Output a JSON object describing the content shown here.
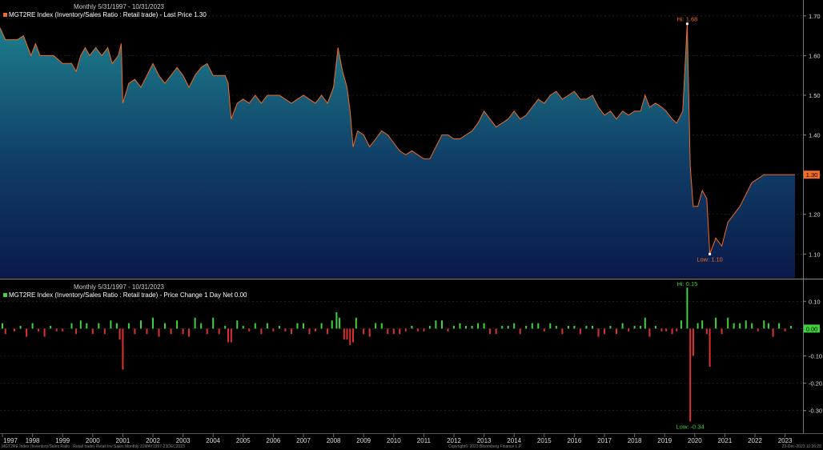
{
  "chart_data": [
    {
      "type": "area",
      "header": "Monthly 5/31/1997 - 10/31/2023",
      "legend": "MGT2RE Index (Inventory/Sales Ratio : Retail trade) - Last Price 1.30",
      "series_color": "#f26b21",
      "last_value": 1.3,
      "last_label": "1.30",
      "hi_label": "Hi: 1.68",
      "hi": {
        "x": 2020.25,
        "y": 1.68
      },
      "low_label": "Low: 1.10",
      "low": {
        "x": 2021.0,
        "y": 1.1
      },
      "ylim": [
        1.04,
        1.74
      ],
      "yticks": [
        1.1,
        1.2,
        1.3,
        1.4,
        1.5,
        1.6,
        1.7
      ],
      "ytick_labels": [
        "1.10",
        "1.20",
        "1.30",
        "1.40",
        "1.50",
        "1.60",
        "1.70"
      ],
      "points": [
        [
          1997.42,
          1.67
        ],
        [
          1997.6,
          1.64
        ],
        [
          1998.0,
          1.64
        ],
        [
          1998.2,
          1.65
        ],
        [
          1998.35,
          1.62
        ],
        [
          1998.45,
          1.6
        ],
        [
          1998.6,
          1.63
        ],
        [
          1998.75,
          1.6
        ],
        [
          1999.0,
          1.6
        ],
        [
          1999.2,
          1.6
        ],
        [
          1999.5,
          1.58
        ],
        [
          1999.8,
          1.58
        ],
        [
          1999.95,
          1.56
        ],
        [
          2000.1,
          1.6
        ],
        [
          2000.25,
          1.62
        ],
        [
          2000.4,
          1.6
        ],
        [
          2000.6,
          1.62
        ],
        [
          2000.8,
          1.6
        ],
        [
          2001.0,
          1.62
        ],
        [
          2001.15,
          1.58
        ],
        [
          2001.35,
          1.6
        ],
        [
          2001.45,
          1.63
        ],
        [
          2001.5,
          1.48
        ],
        [
          2001.7,
          1.53
        ],
        [
          2001.9,
          1.54
        ],
        [
          2002.1,
          1.52
        ],
        [
          2002.3,
          1.55
        ],
        [
          2002.5,
          1.58
        ],
        [
          2002.7,
          1.55
        ],
        [
          2002.9,
          1.53
        ],
        [
          2003.1,
          1.55
        ],
        [
          2003.3,
          1.57
        ],
        [
          2003.5,
          1.55
        ],
        [
          2003.7,
          1.52
        ],
        [
          2003.9,
          1.55
        ],
        [
          2004.1,
          1.57
        ],
        [
          2004.3,
          1.58
        ],
        [
          2004.5,
          1.55
        ],
        [
          2004.7,
          1.55
        ],
        [
          2004.9,
          1.55
        ],
        [
          2005.0,
          1.53
        ],
        [
          2005.1,
          1.44
        ],
        [
          2005.3,
          1.48
        ],
        [
          2005.5,
          1.49
        ],
        [
          2005.7,
          1.48
        ],
        [
          2005.9,
          1.5
        ],
        [
          2006.1,
          1.48
        ],
        [
          2006.3,
          1.5
        ],
        [
          2006.5,
          1.5
        ],
        [
          2006.7,
          1.5
        ],
        [
          2006.9,
          1.49
        ],
        [
          2007.1,
          1.48
        ],
        [
          2007.3,
          1.49
        ],
        [
          2007.5,
          1.5
        ],
        [
          2007.7,
          1.49
        ],
        [
          2007.9,
          1.48
        ],
        [
          2008.1,
          1.5
        ],
        [
          2008.3,
          1.48
        ],
        [
          2008.5,
          1.52
        ],
        [
          2008.65,
          1.62
        ],
        [
          2008.8,
          1.56
        ],
        [
          2008.95,
          1.52
        ],
        [
          2009.05,
          1.46
        ],
        [
          2009.15,
          1.37
        ],
        [
          2009.3,
          1.41
        ],
        [
          2009.5,
          1.4
        ],
        [
          2009.7,
          1.37
        ],
        [
          2009.9,
          1.39
        ],
        [
          2010.1,
          1.41
        ],
        [
          2010.3,
          1.4
        ],
        [
          2010.5,
          1.38
        ],
        [
          2010.7,
          1.36
        ],
        [
          2010.9,
          1.35
        ],
        [
          2011.1,
          1.36
        ],
        [
          2011.3,
          1.35
        ],
        [
          2011.5,
          1.34
        ],
        [
          2011.7,
          1.34
        ],
        [
          2011.9,
          1.37
        ],
        [
          2012.1,
          1.4
        ],
        [
          2012.3,
          1.4
        ],
        [
          2012.5,
          1.39
        ],
        [
          2012.7,
          1.39
        ],
        [
          2012.9,
          1.4
        ],
        [
          2013.1,
          1.41
        ],
        [
          2013.3,
          1.43
        ],
        [
          2013.5,
          1.46
        ],
        [
          2013.7,
          1.44
        ],
        [
          2013.9,
          1.42
        ],
        [
          2014.1,
          1.43
        ],
        [
          2014.3,
          1.44
        ],
        [
          2014.5,
          1.46
        ],
        [
          2014.7,
          1.44
        ],
        [
          2014.9,
          1.45
        ],
        [
          2015.1,
          1.47
        ],
        [
          2015.3,
          1.49
        ],
        [
          2015.5,
          1.48
        ],
        [
          2015.7,
          1.5
        ],
        [
          2015.9,
          1.51
        ],
        [
          2016.1,
          1.49
        ],
        [
          2016.3,
          1.5
        ],
        [
          2016.5,
          1.51
        ],
        [
          2016.7,
          1.49
        ],
        [
          2016.9,
          1.49
        ],
        [
          2017.1,
          1.5
        ],
        [
          2017.3,
          1.47
        ],
        [
          2017.5,
          1.45
        ],
        [
          2017.7,
          1.46
        ],
        [
          2017.9,
          1.44
        ],
        [
          2018.1,
          1.46
        ],
        [
          2018.3,
          1.45
        ],
        [
          2018.5,
          1.46
        ],
        [
          2018.7,
          1.46
        ],
        [
          2018.85,
          1.5
        ],
        [
          2019.0,
          1.47
        ],
        [
          2019.2,
          1.48
        ],
        [
          2019.4,
          1.47
        ],
        [
          2019.55,
          1.46
        ],
        [
          2019.75,
          1.44
        ],
        [
          2019.9,
          1.43
        ],
        [
          2020.1,
          1.46
        ],
        [
          2020.25,
          1.68
        ],
        [
          2020.35,
          1.32
        ],
        [
          2020.45,
          1.22
        ],
        [
          2020.6,
          1.22
        ],
        [
          2020.75,
          1.26
        ],
        [
          2020.9,
          1.24
        ],
        [
          2021.0,
          1.1
        ],
        [
          2021.2,
          1.14
        ],
        [
          2021.4,
          1.12
        ],
        [
          2021.6,
          1.18
        ],
        [
          2021.8,
          1.2
        ],
        [
          2022.0,
          1.22
        ],
        [
          2022.2,
          1.25
        ],
        [
          2022.4,
          1.28
        ],
        [
          2022.6,
          1.29
        ],
        [
          2022.8,
          1.3
        ],
        [
          2023.0,
          1.3
        ],
        [
          2023.2,
          1.3
        ],
        [
          2023.5,
          1.3
        ],
        [
          2023.83,
          1.3
        ]
      ]
    },
    {
      "type": "bar",
      "header": "Monthly 5/31/1997 - 10/31/2023",
      "legend": "MGT2RE Index (Inventory/Sales Ratio : Retail trade) - Price Change 1 Day Net 0.00",
      "positive_color": "#3fd23f",
      "negative_color": "#e03131",
      "last_value": 0.0,
      "last_label": "0.00",
      "hi_label": "Hi: 0.15",
      "hi": {
        "x": 2020.25,
        "y": 0.15
      },
      "low_label": "Low: -0.34",
      "low": {
        "x": 2020.35,
        "y": -0.34
      },
      "ylim": [
        -0.38,
        0.18
      ],
      "yticks": [
        0.1,
        0.0,
        -0.1,
        -0.2,
        -0.3
      ],
      "ytick_labels": [
        "0.10",
        "0.00",
        "-0.10",
        "-0.20",
        "-0.30"
      ],
      "points": [
        [
          1997.5,
          0.02
        ],
        [
          1997.6,
          -0.02
        ],
        [
          1997.9,
          -0.01
        ],
        [
          1998.1,
          0.01
        ],
        [
          1998.3,
          -0.03
        ],
        [
          1998.5,
          0.02
        ],
        [
          1998.7,
          -0.01
        ],
        [
          1998.9,
          -0.03
        ],
        [
          1999.1,
          0.01
        ],
        [
          1999.3,
          -0.01
        ],
        [
          1999.5,
          -0.01
        ],
        [
          1999.8,
          0.02
        ],
        [
          1999.95,
          -0.02
        ],
        [
          2000.1,
          0.03
        ],
        [
          2000.3,
          0.02
        ],
        [
          2000.5,
          -0.02
        ],
        [
          2000.7,
          0.02
        ],
        [
          2000.9,
          -0.02
        ],
        [
          2001.1,
          0.03
        ],
        [
          2001.3,
          0.02
        ],
        [
          2001.4,
          -0.04
        ],
        [
          2001.5,
          -0.15
        ],
        [
          2001.7,
          0.02
        ],
        [
          2001.9,
          -0.02
        ],
        [
          2002.1,
          0.03
        ],
        [
          2002.3,
          -0.02
        ],
        [
          2002.5,
          0.04
        ],
        [
          2002.7,
          -0.03
        ],
        [
          2002.9,
          0.02
        ],
        [
          2003.1,
          -0.02
        ],
        [
          2003.3,
          0.03
        ],
        [
          2003.5,
          -0.02
        ],
        [
          2003.7,
          -0.03
        ],
        [
          2003.9,
          0.04
        ],
        [
          2004.1,
          0.02
        ],
        [
          2004.3,
          -0.02
        ],
        [
          2004.5,
          0.04
        ],
        [
          2004.7,
          -0.02
        ],
        [
          2004.9,
          0.01
        ],
        [
          2005.0,
          -0.05
        ],
        [
          2005.1,
          -0.05
        ],
        [
          2005.3,
          0.03
        ],
        [
          2005.5,
          0.01
        ],
        [
          2005.7,
          -0.01
        ],
        [
          2005.9,
          0.02
        ],
        [
          2006.1,
          -0.02
        ],
        [
          2006.3,
          0.02
        ],
        [
          2006.5,
          -0.01
        ],
        [
          2006.7,
          0.01
        ],
        [
          2006.9,
          -0.01
        ],
        [
          2007.1,
          -0.02
        ],
        [
          2007.3,
          0.02
        ],
        [
          2007.5,
          0.02
        ],
        [
          2007.7,
          -0.02
        ],
        [
          2007.9,
          -0.01
        ],
        [
          2008.1,
          0.02
        ],
        [
          2008.3,
          -0.02
        ],
        [
          2008.45,
          0.03
        ],
        [
          2008.6,
          0.06
        ],
        [
          2008.7,
          0.04
        ],
        [
          2008.85,
          -0.04
        ],
        [
          2008.95,
          -0.04
        ],
        [
          2009.05,
          -0.06
        ],
        [
          2009.15,
          -0.05
        ],
        [
          2009.25,
          0.04
        ],
        [
          2009.5,
          -0.02
        ],
        [
          2009.7,
          -0.03
        ],
        [
          2009.9,
          0.02
        ],
        [
          2010.1,
          0.02
        ],
        [
          2010.3,
          -0.02
        ],
        [
          2010.5,
          -0.02
        ],
        [
          2010.7,
          -0.02
        ],
        [
          2010.9,
          -0.01
        ],
        [
          2011.1,
          0.01
        ],
        [
          2011.3,
          -0.01
        ],
        [
          2011.5,
          -0.01
        ],
        [
          2011.7,
          0.01
        ],
        [
          2011.9,
          0.03
        ],
        [
          2012.1,
          0.03
        ],
        [
          2012.3,
          -0.01
        ],
        [
          2012.5,
          0.01
        ],
        [
          2012.7,
          0.02
        ],
        [
          2012.9,
          0.01
        ],
        [
          2013.1,
          0.01
        ],
        [
          2013.3,
          0.02
        ],
        [
          2013.5,
          0.02
        ],
        [
          2013.7,
          -0.02
        ],
        [
          2013.9,
          -0.02
        ],
        [
          2014.1,
          0.01
        ],
        [
          2014.3,
          0.01
        ],
        [
          2014.5,
          0.02
        ],
        [
          2014.7,
          -0.02
        ],
        [
          2014.9,
          0.01
        ],
        [
          2015.1,
          0.02
        ],
        [
          2015.3,
          0.02
        ],
        [
          2015.5,
          -0.01
        ],
        [
          2015.7,
          0.02
        ],
        [
          2015.9,
          0.01
        ],
        [
          2016.1,
          -0.02
        ],
        [
          2016.3,
          0.01
        ],
        [
          2016.5,
          0.01
        ],
        [
          2016.7,
          -0.02
        ],
        [
          2016.9,
          0.01
        ],
        [
          2017.1,
          0.01
        ],
        [
          2017.3,
          -0.03
        ],
        [
          2017.5,
          -0.02
        ],
        [
          2017.7,
          0.01
        ],
        [
          2017.9,
          -0.02
        ],
        [
          2018.1,
          0.02
        ],
        [
          2018.3,
          -0.01
        ],
        [
          2018.5,
          0.01
        ],
        [
          2018.7,
          0.01
        ],
        [
          2018.85,
          0.04
        ],
        [
          2019.0,
          -0.03
        ],
        [
          2019.2,
          0.01
        ],
        [
          2019.4,
          -0.01
        ],
        [
          2019.55,
          -0.01
        ],
        [
          2019.75,
          -0.02
        ],
        [
          2019.9,
          -0.01
        ],
        [
          2020.05,
          0.03
        ],
        [
          2020.25,
          0.15
        ],
        [
          2020.35,
          -0.34
        ],
        [
          2020.45,
          -0.1
        ],
        [
          2020.6,
          0.02
        ],
        [
          2020.75,
          0.03
        ],
        [
          2020.9,
          -0.02
        ],
        [
          2021.0,
          -0.14
        ],
        [
          2021.2,
          0.04
        ],
        [
          2021.4,
          -0.02
        ],
        [
          2021.6,
          0.04
        ],
        [
          2021.8,
          0.02
        ],
        [
          2022.0,
          0.02
        ],
        [
          2022.2,
          0.03
        ],
        [
          2022.4,
          0.02
        ],
        [
          2022.6,
          -0.01
        ],
        [
          2022.8,
          0.03
        ],
        [
          2022.95,
          0.02
        ],
        [
          2023.1,
          -0.03
        ],
        [
          2023.3,
          0.02
        ],
        [
          2023.5,
          -0.01
        ],
        [
          2023.7,
          0.01
        ]
      ]
    }
  ],
  "x_axis": {
    "xlim": [
      1997.42,
      2023.83
    ],
    "years": [
      "1997",
      "1998",
      "1999",
      "2000",
      "2001",
      "2002",
      "2003",
      "2004",
      "2005",
      "2006",
      "2007",
      "2008",
      "2009",
      "2010",
      "2011",
      "2012",
      "2013",
      "2014",
      "2015",
      "2016",
      "2017",
      "2018",
      "2019",
      "2020",
      "2021",
      "2022",
      "2023"
    ]
  },
  "footer": {
    "left": "MGT2RE Index (Inventory/Sales Ratio : Retail trade) Retail Inv:Sales  Monthly 31MAY1997-23DEC2023",
    "center": "Copyright© 2023 Bloomberg Finance L.P.",
    "right": "23-Dec-2023 11:26:25"
  }
}
